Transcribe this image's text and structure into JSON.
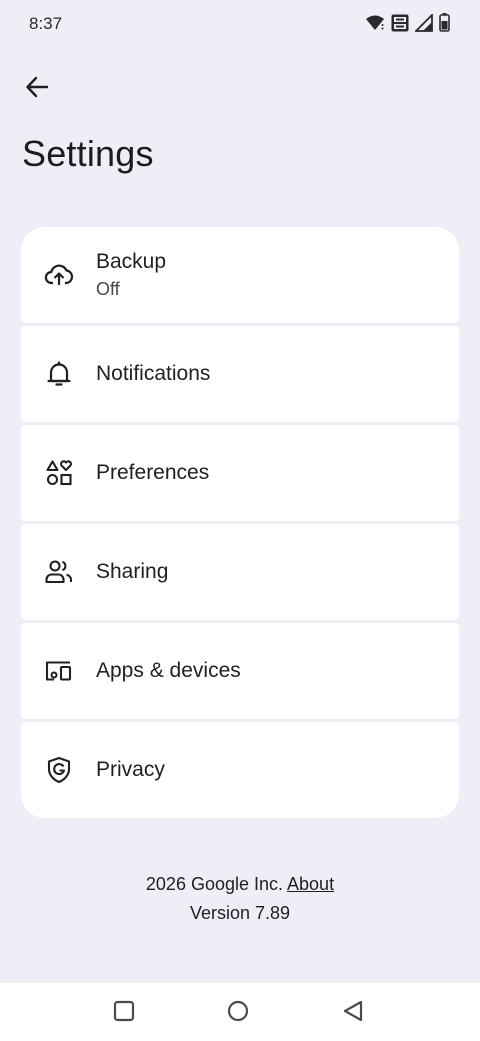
{
  "status_bar": {
    "time": "8:37",
    "icons": [
      "wifi-icon",
      "volte-icon",
      "signal-icon",
      "battery-icon"
    ]
  },
  "header": {
    "back_icon": "arrow-back-icon",
    "title": "Settings"
  },
  "settings": {
    "items": [
      {
        "id": "backup",
        "label": "Backup",
        "sublabel": "Off",
        "icon": "cloud-upload-icon"
      },
      {
        "id": "notifications",
        "label": "Notifications",
        "icon": "bell-icon"
      },
      {
        "id": "preferences",
        "label": "Preferences",
        "icon": "shapes-icon"
      },
      {
        "id": "sharing",
        "label": "Sharing",
        "icon": "people-icon"
      },
      {
        "id": "apps-devices",
        "label": "Apps & devices",
        "icon": "devices-icon"
      },
      {
        "id": "privacy",
        "label": "Privacy",
        "icon": "google-shield-icon"
      }
    ]
  },
  "footer": {
    "copyright": "2026 Google Inc.",
    "about_link": "About",
    "version": "Version 7.89"
  },
  "nav_bar": {
    "buttons": [
      "recents-icon",
      "home-icon",
      "back-triangle-icon"
    ]
  },
  "colors": {
    "background": "#efedf6",
    "card": "#ffffff",
    "text": "#1f1f24"
  }
}
